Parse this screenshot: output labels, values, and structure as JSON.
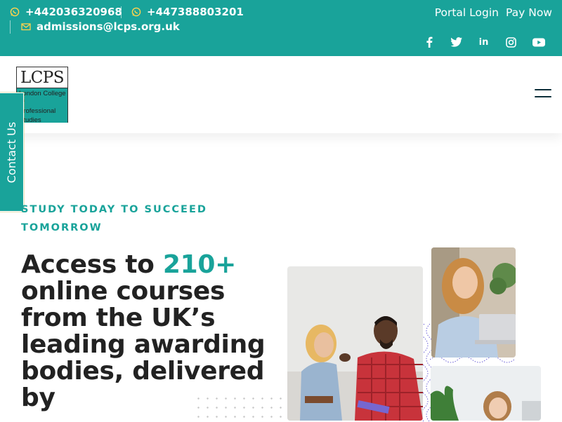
{
  "topbar": {
    "phone_1": "+442036320968",
    "phone_2": "+447388803201",
    "email": "admissions@lcps.org.uk",
    "portal_login": "Portal Login",
    "pay_now": "Pay Now",
    "social": {
      "facebook": "f",
      "twitter": "🐦",
      "linkedin": "in",
      "instagram": "◎",
      "youtube": "▶"
    }
  },
  "logo": {
    "abbr": "LCPS",
    "full": "London College of\nProfessional\nStudies"
  },
  "contact_tab": "Contact Us",
  "hero": {
    "eyebrow": "STUDY TODAY TO SUCCEED TOMORROW",
    "headline_prefix": "Access to ",
    "headline_accent": "210+",
    "headline_rest": "online courses from the UK’s leading awarding bodies, delivered by"
  },
  "colors": {
    "brand_teal": "#19a39a",
    "heading_dark": "#222222",
    "whatsapp_icon": "#ffd34d",
    "mail_icon": "#ffd34d"
  }
}
